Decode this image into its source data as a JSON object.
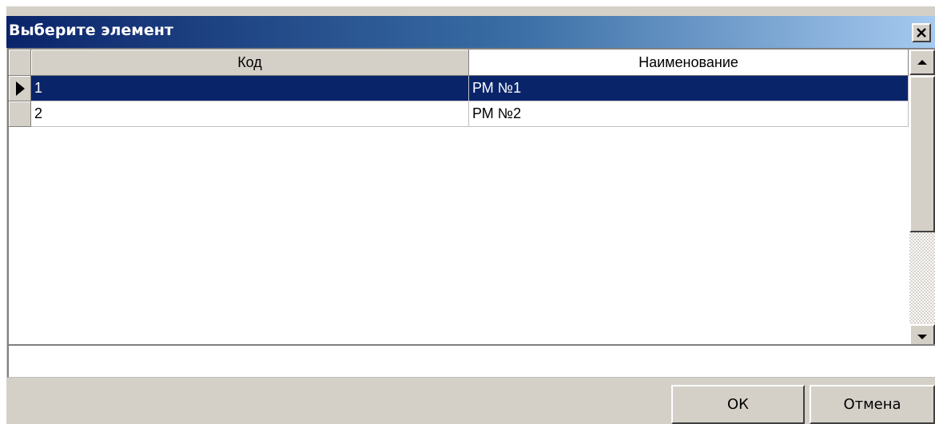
{
  "dialog": {
    "title": "Выберите элемент",
    "close_glyph": "✕"
  },
  "grid": {
    "columns": [
      "Код",
      "Наименование"
    ],
    "rows": [
      {
        "code": "1",
        "name": "РМ №1",
        "selected": true
      },
      {
        "code": "2",
        "name": "РМ №2",
        "selected": false
      }
    ]
  },
  "buttons": {
    "ok_label": "ОК",
    "cancel_label": "Отмена"
  },
  "colors": {
    "selection": "#0a246a",
    "title_gradient_start": "#0a246a",
    "title_gradient_end": "#a6caf0",
    "face": "#d4d0c8"
  },
  "icons": {
    "row_indicator": "triangle-right-icon",
    "scroll_up": "arrow-up-icon",
    "scroll_down": "arrow-down-icon",
    "close": "close-icon"
  }
}
